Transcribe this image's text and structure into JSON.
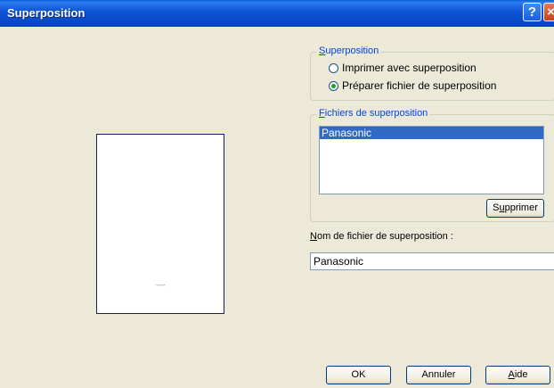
{
  "window": {
    "title": "Superposition",
    "help_glyph": "?",
    "close_glyph": "×"
  },
  "preview": {
    "dots": "----"
  },
  "superposition_group": {
    "legend_first": "S",
    "legend_rest": "uperposition",
    "options": [
      {
        "label": "Imprimer avec superposition",
        "selected": false
      },
      {
        "label": "Préparer fichier de superposition",
        "selected": true
      }
    ]
  },
  "files_group": {
    "legend_first": "F",
    "legend_rest": "ichiers de superposition",
    "items": [
      "Panasonic"
    ],
    "delete_first": "S",
    "delete_u": "u",
    "delete_rest": "pprimer"
  },
  "filename": {
    "label_first": "N",
    "label_rest": "om de fichier de superposition :",
    "value": "Panasonic"
  },
  "buttons": {
    "ok": "OK",
    "cancel": "Annuler",
    "help_first": "A",
    "help_rest": "ide"
  },
  "colors": {
    "titlebar": "#0a4fd6",
    "legend_text": "#0046d5",
    "selection": "#316ac5",
    "radio_dot": "#21a121"
  }
}
